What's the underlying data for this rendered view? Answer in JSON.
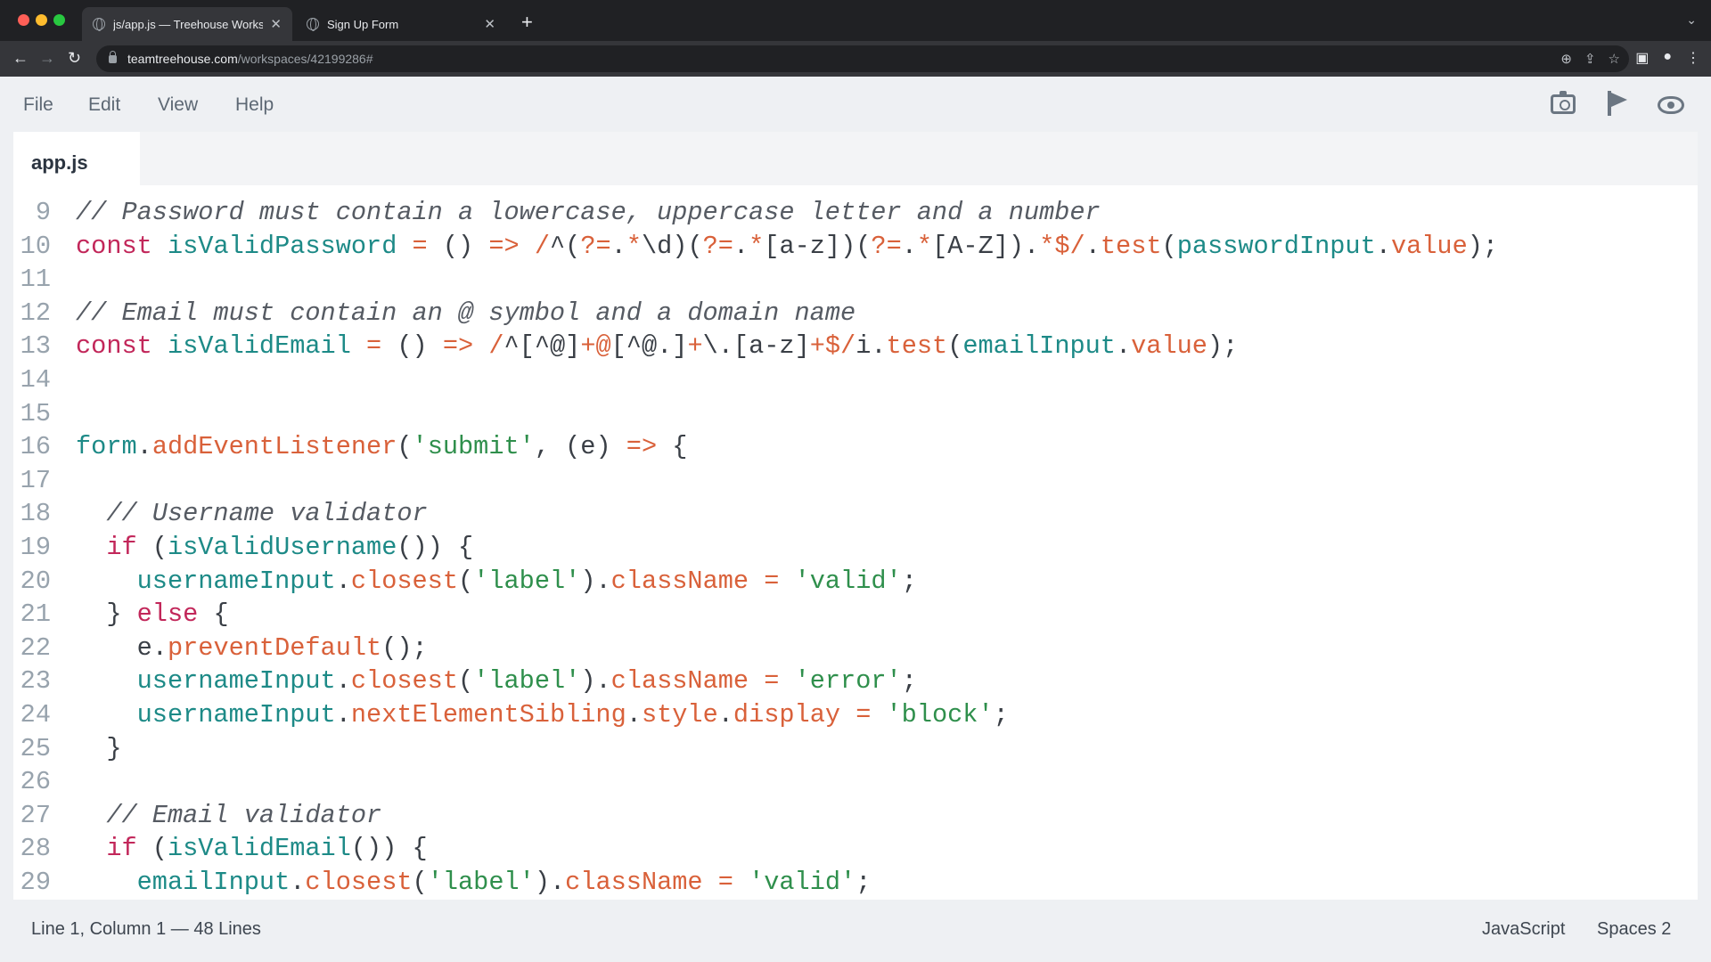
{
  "browser": {
    "tabs": [
      {
        "title": "js/app.js — Treehouse Workspace",
        "close": "✕",
        "icon": "globe-icon"
      },
      {
        "title": "Sign Up Form",
        "close": "✕",
        "icon": "globe-icon"
      }
    ],
    "new_tab": "+",
    "url_host": "teamtreehouse.com",
    "url_path": "/workspaces/42199286#"
  },
  "app": {
    "menu": [
      "File",
      "Edit",
      "View",
      "Help"
    ],
    "file_tab": "app.js",
    "code_lines": [
      {
        "n": "9",
        "t": [
          [
            "com",
            "// Password must contain a lowercase, uppercase letter and a number"
          ]
        ]
      },
      {
        "n": "10",
        "t": [
          [
            "kw",
            "const "
          ],
          [
            "ident",
            "isValidPassword"
          ],
          [
            "op",
            " = "
          ],
          [
            "punc",
            "() "
          ],
          [
            "op",
            "=> "
          ],
          [
            "op",
            "/"
          ],
          [
            "punc",
            "^("
          ],
          [
            "op",
            "?="
          ],
          [
            "punc",
            "."
          ],
          [
            "op",
            "*"
          ],
          [
            "punc",
            "\\d)("
          ],
          [
            "op",
            "?="
          ],
          [
            "punc",
            "."
          ],
          [
            "op",
            "*"
          ],
          [
            "punc",
            "[a-z])("
          ],
          [
            "op",
            "?="
          ],
          [
            "punc",
            "."
          ],
          [
            "op",
            "*"
          ],
          [
            "punc",
            "[A-Z])."
          ],
          [
            "op",
            "*$/"
          ],
          [
            "punc",
            "."
          ],
          [
            "op",
            "test"
          ],
          [
            "punc",
            "("
          ],
          [
            "ident",
            "passwordInput"
          ],
          [
            "punc",
            "."
          ],
          [
            "prop",
            "value"
          ],
          [
            "punc",
            ");"
          ]
        ]
      },
      {
        "n": "11",
        "t": []
      },
      {
        "n": "12",
        "t": [
          [
            "com",
            "// Email must contain an @ symbol and a domain name"
          ]
        ]
      },
      {
        "n": "13",
        "t": [
          [
            "kw",
            "const "
          ],
          [
            "ident",
            "isValidEmail"
          ],
          [
            "op",
            " = "
          ],
          [
            "punc",
            "() "
          ],
          [
            "op",
            "=> "
          ],
          [
            "op",
            "/"
          ],
          [
            "punc",
            "^[^@]"
          ],
          [
            "op",
            "+@"
          ],
          [
            "punc",
            "[^@.]"
          ],
          [
            "op",
            "+"
          ],
          [
            "punc",
            "\\.[a-z]"
          ],
          [
            "op",
            "+$/"
          ],
          [
            "punc",
            "i."
          ],
          [
            "op",
            "test"
          ],
          [
            "punc",
            "("
          ],
          [
            "ident",
            "emailInput"
          ],
          [
            "punc",
            "."
          ],
          [
            "prop",
            "value"
          ],
          [
            "punc",
            ");"
          ]
        ]
      },
      {
        "n": "14",
        "t": []
      },
      {
        "n": "15",
        "t": []
      },
      {
        "n": "16",
        "t": [
          [
            "ident",
            "form"
          ],
          [
            "punc",
            "."
          ],
          [
            "prop",
            "addEventListener"
          ],
          [
            "punc",
            "("
          ],
          [
            "str",
            "'submit'"
          ],
          [
            "punc",
            ", ("
          ],
          [
            "param",
            "e"
          ],
          [
            "punc",
            ") "
          ],
          [
            "op",
            "=>"
          ],
          [
            "punc",
            " {"
          ]
        ]
      },
      {
        "n": "17",
        "t": []
      },
      {
        "n": "18",
        "t": [
          [
            "com",
            "  // Username validator"
          ]
        ]
      },
      {
        "n": "19",
        "t": [
          [
            "kw",
            "  if "
          ],
          [
            "punc",
            "("
          ],
          [
            "ident",
            "isValidUsername"
          ],
          [
            "punc",
            "()) {"
          ]
        ]
      },
      {
        "n": "20",
        "t": [
          [
            "ident",
            "    usernameInput"
          ],
          [
            "punc",
            "."
          ],
          [
            "prop",
            "closest"
          ],
          [
            "punc",
            "("
          ],
          [
            "str",
            "'label'"
          ],
          [
            "punc",
            ")."
          ],
          [
            "prop",
            "className"
          ],
          [
            "op",
            " = "
          ],
          [
            "str",
            "'valid'"
          ],
          [
            "punc",
            ";"
          ]
        ]
      },
      {
        "n": "21",
        "t": [
          [
            "punc",
            "  } "
          ],
          [
            "kw",
            "else "
          ],
          [
            "punc",
            "{"
          ]
        ]
      },
      {
        "n": "22",
        "t": [
          [
            "param",
            "    e"
          ],
          [
            "punc",
            "."
          ],
          [
            "prop",
            "preventDefault"
          ],
          [
            "punc",
            "();"
          ]
        ]
      },
      {
        "n": "23",
        "t": [
          [
            "ident",
            "    usernameInput"
          ],
          [
            "punc",
            "."
          ],
          [
            "prop",
            "closest"
          ],
          [
            "punc",
            "("
          ],
          [
            "str",
            "'label'"
          ],
          [
            "punc",
            ")."
          ],
          [
            "prop",
            "className"
          ],
          [
            "op",
            " = "
          ],
          [
            "str",
            "'error'"
          ],
          [
            "punc",
            ";"
          ]
        ]
      },
      {
        "n": "24",
        "t": [
          [
            "ident",
            "    usernameInput"
          ],
          [
            "punc",
            "."
          ],
          [
            "prop",
            "nextElementSibling"
          ],
          [
            "punc",
            "."
          ],
          [
            "prop",
            "style"
          ],
          [
            "punc",
            "."
          ],
          [
            "prop",
            "display"
          ],
          [
            "op",
            " = "
          ],
          [
            "str",
            "'block'"
          ],
          [
            "punc",
            ";"
          ]
        ]
      },
      {
        "n": "25",
        "t": [
          [
            "punc",
            "  }"
          ]
        ]
      },
      {
        "n": "26",
        "t": []
      },
      {
        "n": "27",
        "t": [
          [
            "com",
            "  // Email validator"
          ]
        ]
      },
      {
        "n": "28",
        "t": [
          [
            "kw",
            "  if "
          ],
          [
            "punc",
            "("
          ],
          [
            "ident",
            "isValidEmail"
          ],
          [
            "punc",
            "()) {"
          ]
        ]
      },
      {
        "n": "29",
        "t": [
          [
            "ident",
            "    emailInput"
          ],
          [
            "punc",
            "."
          ],
          [
            "prop",
            "closest"
          ],
          [
            "punc",
            "("
          ],
          [
            "str",
            "'label'"
          ],
          [
            "punc",
            ")."
          ],
          [
            "prop",
            "className"
          ],
          [
            "op",
            " = "
          ],
          [
            "str",
            "'valid'"
          ],
          [
            "punc",
            ";"
          ]
        ]
      }
    ],
    "status": {
      "position": "Line 1, Column 1 — 48 Lines",
      "language": "JavaScript",
      "spaces": "Spaces  2"
    }
  }
}
